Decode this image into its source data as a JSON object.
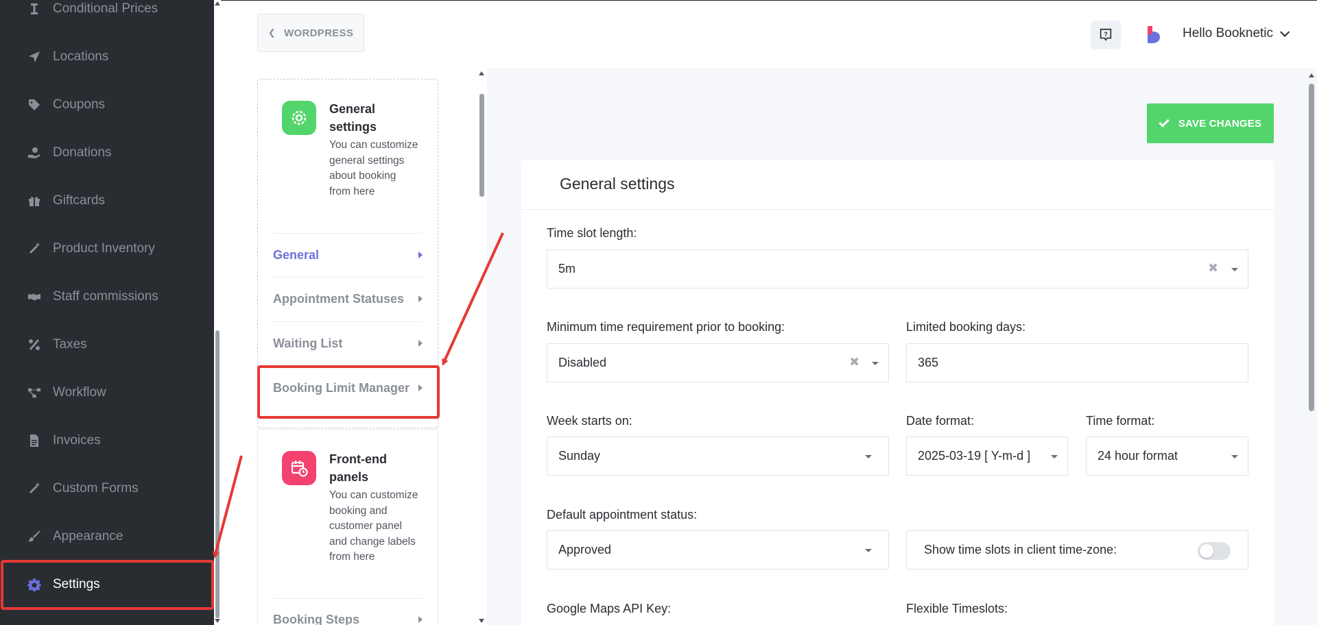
{
  "sidebar": {
    "items": [
      {
        "label": "Conditional Prices",
        "icon": "price-tag-cursor-icon"
      },
      {
        "label": "Locations",
        "icon": "location-arrow-icon"
      },
      {
        "label": "Coupons",
        "icon": "tag-icon"
      },
      {
        "label": "Donations",
        "icon": "donation-hand-icon"
      },
      {
        "label": "Giftcards",
        "icon": "gift-icon"
      },
      {
        "label": "Product Inventory",
        "icon": "magic-wand-icon"
      },
      {
        "label": "Staff commissions",
        "icon": "handshake-icon"
      },
      {
        "label": "Taxes",
        "icon": "percent-icon"
      },
      {
        "label": "Workflow",
        "icon": "workflow-icon"
      },
      {
        "label": "Invoices",
        "icon": "invoice-icon"
      },
      {
        "label": "Custom Forms",
        "icon": "magic-wand-icon"
      },
      {
        "label": "Appearance",
        "icon": "brush-icon"
      },
      {
        "label": "Settings",
        "icon": "gear-icon",
        "active": true
      }
    ]
  },
  "header": {
    "back_label": "WORDPRESS",
    "user_greeting": "Hello Booknetic"
  },
  "settings_nav": {
    "general_card": {
      "title": "General settings",
      "description": "You can customize general settings about booking from here",
      "links": [
        "General",
        "Appointment Statuses",
        "Waiting List",
        "Booking Limit Manager"
      ]
    },
    "frontend_card": {
      "title": "Front-end panels",
      "description": "You can customize booking and customer panel and change labels from here",
      "links": [
        "Booking Steps"
      ]
    }
  },
  "main": {
    "save_label": "SAVE CHANGES",
    "panel_title": "General settings",
    "fields": {
      "time_slot_length": {
        "label": "Time slot length:",
        "value": "5m"
      },
      "min_time_prior": {
        "label": "Minimum time requirement prior to booking:",
        "value": "Disabled"
      },
      "limited_booking_days": {
        "label": "Limited booking days:",
        "value": "365"
      },
      "week_starts_on": {
        "label": "Week starts on:",
        "value": "Sunday"
      },
      "date_format": {
        "label": "Date format:",
        "value": "2025-03-19 [ Y-m-d ]"
      },
      "time_format": {
        "label": "Time format:",
        "value": "24 hour format"
      },
      "default_status": {
        "label": "Default appointment status:",
        "value": "Approved"
      },
      "client_timezone": {
        "label": "Show time slots in client time-zone:",
        "enabled": false
      },
      "google_maps_key": {
        "label": "Google Maps API Key:"
      },
      "flexible_timeslots": {
        "label": "Flexible Timeslots:"
      }
    }
  },
  "colors": {
    "sidebar_bg": "#292d32",
    "accent": "#6c70dc",
    "save_green": "#53d56c",
    "annotation_red": "#e53935"
  }
}
